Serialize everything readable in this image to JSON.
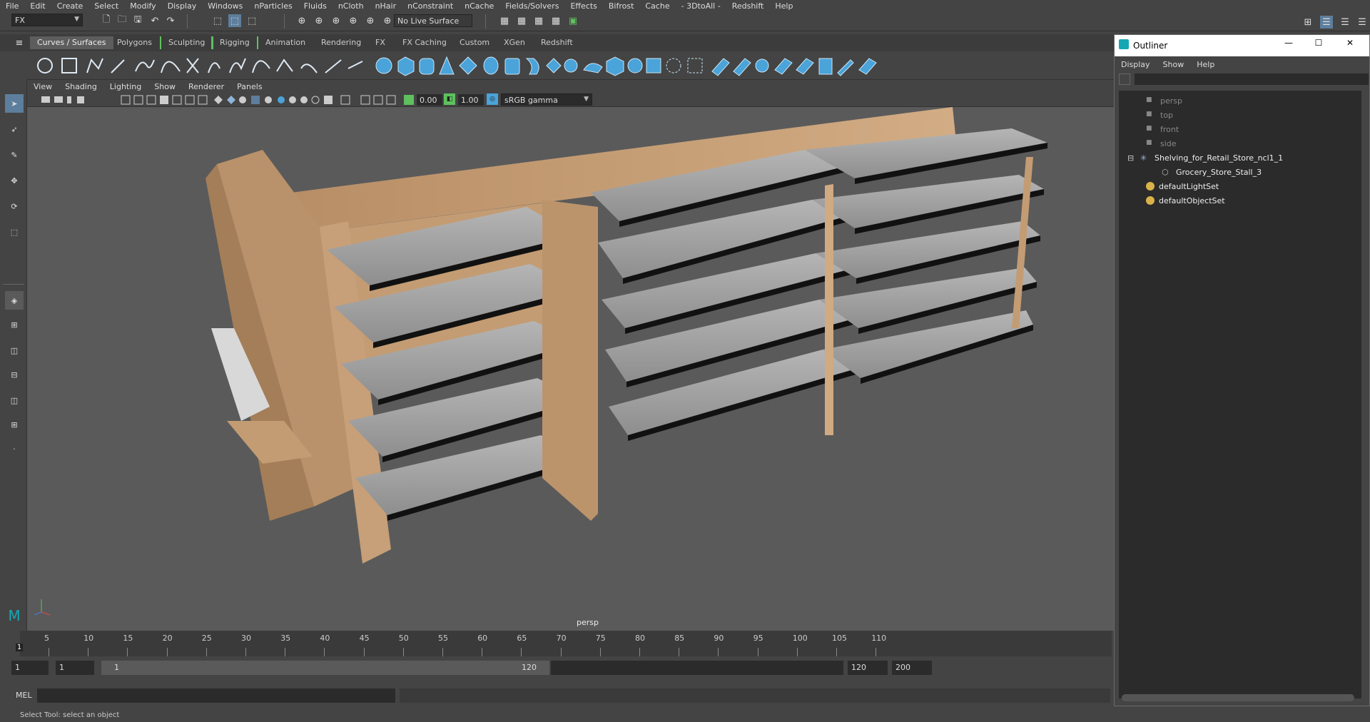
{
  "menubar": {
    "items": [
      "File",
      "Edit",
      "Create",
      "Select",
      "Modify",
      "Display",
      "Windows",
      "nParticles",
      "Fluids",
      "nCloth",
      "nHair",
      "nConstraint",
      "nCache",
      "Fields/Solvers",
      "Effects",
      "Bifrost",
      "Cache",
      "- 3DtoAll -",
      "Redshift",
      "Help"
    ]
  },
  "statusline": {
    "menuset": "FX",
    "live_surface": "No Live Surface"
  },
  "shelf": {
    "tabs": [
      "Curves / Surfaces",
      "Polygons",
      "Sculpting",
      "Rigging",
      "Animation",
      "Rendering",
      "FX",
      "FX Caching",
      "Custom",
      "XGen",
      "Redshift"
    ],
    "active_tab": "Curves / Surfaces"
  },
  "panel": {
    "menu": [
      "View",
      "Shading",
      "Lighting",
      "Show",
      "Renderer",
      "Panels"
    ],
    "exposure": "0.00",
    "gamma": "1.00",
    "color_space": "sRGB gamma",
    "camera_label": "persp"
  },
  "timeline": {
    "ticks": [
      "5",
      "10",
      "15",
      "20",
      "25",
      "30",
      "35",
      "40",
      "45",
      "50",
      "55",
      "60",
      "65",
      "70",
      "75",
      "80",
      "85",
      "90",
      "95",
      "100",
      "105",
      "110"
    ],
    "current_frame": "1"
  },
  "range": {
    "start_min": "1",
    "start": "1",
    "slider_start": "1",
    "slider_end": "120",
    "end": "120",
    "end_max": "200"
  },
  "cmdline": {
    "label": "MEL"
  },
  "helpline": {
    "text": "Select Tool: select an object"
  },
  "outliner": {
    "title": "Outliner",
    "menu": [
      "Display",
      "Show",
      "Help"
    ],
    "items": [
      {
        "label": "persp",
        "icon": "camera-icon",
        "dim": true
      },
      {
        "label": "top",
        "icon": "camera-icon",
        "dim": true
      },
      {
        "label": "front",
        "icon": "camera-icon",
        "dim": true
      },
      {
        "label": "side",
        "icon": "camera-icon",
        "dim": true
      },
      {
        "label": "Shelving_for_Retail_Store_ncl1_1",
        "icon": "transform-icon",
        "dim": false
      },
      {
        "label": "Grocery_Store_Stall_3",
        "icon": "mesh-icon",
        "dim": false
      },
      {
        "label": "defaultLightSet",
        "icon": "set-icon",
        "dim": false
      },
      {
        "label": "defaultObjectSet",
        "icon": "set-icon",
        "dim": false
      }
    ]
  },
  "colors": {
    "bg": "#444444",
    "viewport": "#5a5a5a",
    "accent": "#5ec15e",
    "shelf_icon": "#4aa3d9",
    "wood": "#c9a27a",
    "shelf": "#a8a8a8"
  }
}
